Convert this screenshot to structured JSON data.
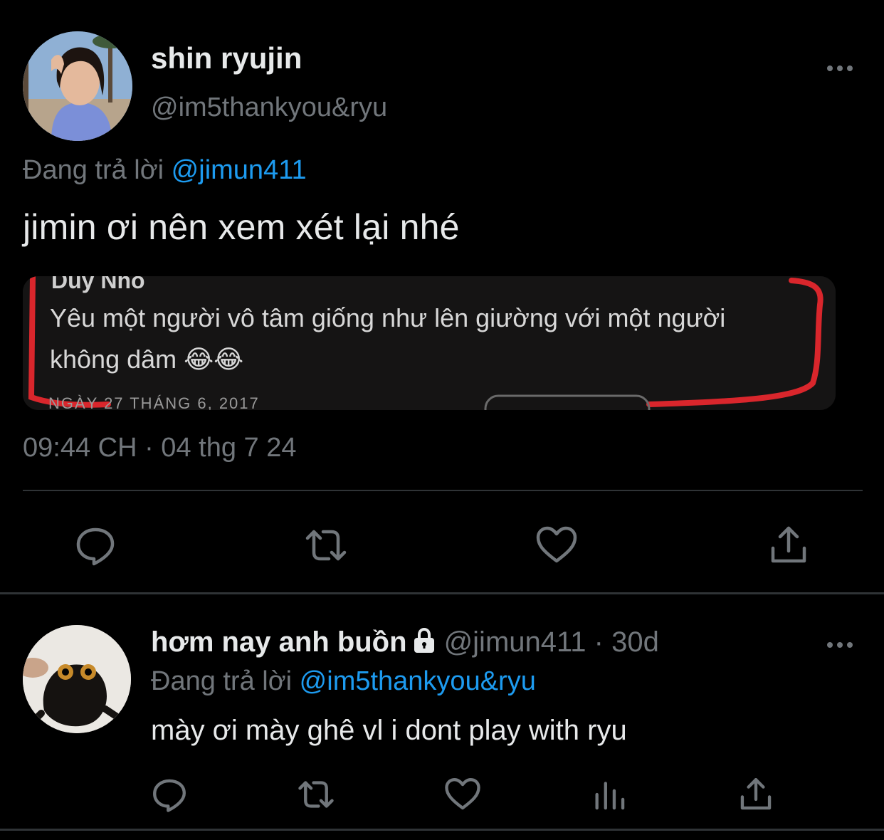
{
  "main_tweet": {
    "display_name": "shin ryujin",
    "handle": "@im5thankyou&ryu",
    "replying_prefix": "Đang trả lời",
    "replying_to": "@jimun411",
    "text": "jimin ơi nên xem xét lại nhé",
    "media": {
      "author_partial": "Duy Nho",
      "line1": "Yêu một người vô tâm giống như lên giường với một người",
      "line2": "không dâm 😂😂",
      "date_partial": "NGÀY 27 THÁNG 6, 2017"
    },
    "timestamp": "09:44 CH · 04 thg 7 24",
    "actions": [
      "reply-icon",
      "retweet-icon",
      "like-icon",
      "share-icon"
    ]
  },
  "reply_tweet": {
    "display_name": "hơm nay anh buồn",
    "handle": "@jimun411",
    "separator": " · ",
    "age": "30d",
    "replying_prefix": "Đang trả lời",
    "replying_to": "@im5thankyou&ryu",
    "text": "mày ơi mày ghê vl i dont play with ryu",
    "actions": [
      "reply-icon",
      "retweet-icon",
      "like-icon",
      "views-icon",
      "share-icon"
    ]
  },
  "colors": {
    "background": "#000000",
    "text": "#e7e9ea",
    "secondary": "#71767b",
    "accent": "#1d9bf0",
    "divider": "#2f3336",
    "media_highlight": "#d9262c"
  }
}
